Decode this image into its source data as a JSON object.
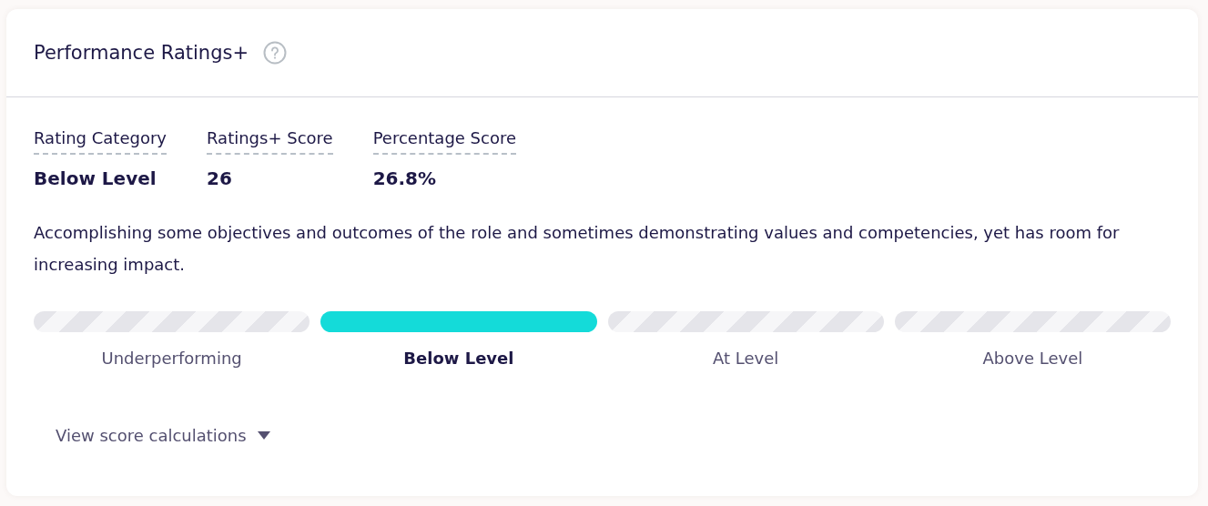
{
  "card": {
    "title": "Performance Ratings+"
  },
  "stats": [
    {
      "label": "Rating Category",
      "value": "Below Level"
    },
    {
      "label": "Ratings+ Score",
      "value": "26"
    },
    {
      "label": "Percentage Score",
      "value": "26.8%"
    }
  ],
  "description": "Accomplishing some objectives and outcomes of the role and sometimes demonstrating values and competencies, yet has room for increasing impact.",
  "levels": [
    {
      "label": "Underperforming",
      "selected": false
    },
    {
      "label": "Below Level",
      "selected": true
    },
    {
      "label": "At Level",
      "selected": false
    },
    {
      "label": "Above Level",
      "selected": false
    }
  ],
  "toggle": {
    "label": "View score calculations",
    "expanded": false
  }
}
